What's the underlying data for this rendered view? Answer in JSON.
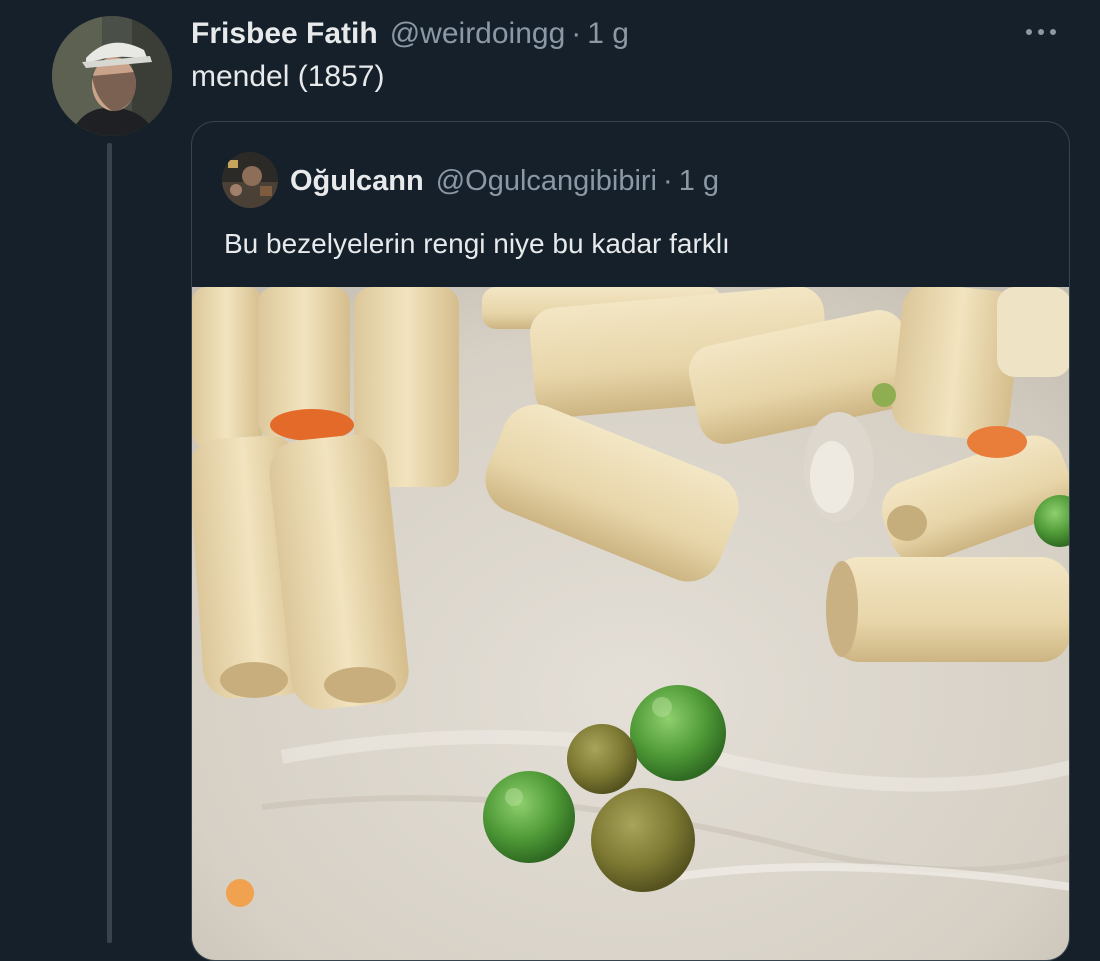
{
  "tweet": {
    "display_name": "Frisbee Fatih",
    "handle": "@weirdoingg",
    "separator": "·",
    "time": "1 g",
    "text": "mendel (1857)",
    "more_icon": "more-horizontal-icon"
  },
  "quoted_tweet": {
    "display_name": "Oğulcann",
    "handle": "@Ogulcangibibiri",
    "separator": "·",
    "time": "1 g",
    "text": "Bu bezelyelerin rengi niye bu kadar farklı"
  },
  "colors": {
    "background": "#15202b",
    "border": "#38444d",
    "text_primary": "#e7e9ea",
    "text_secondary": "#8b98a5"
  }
}
